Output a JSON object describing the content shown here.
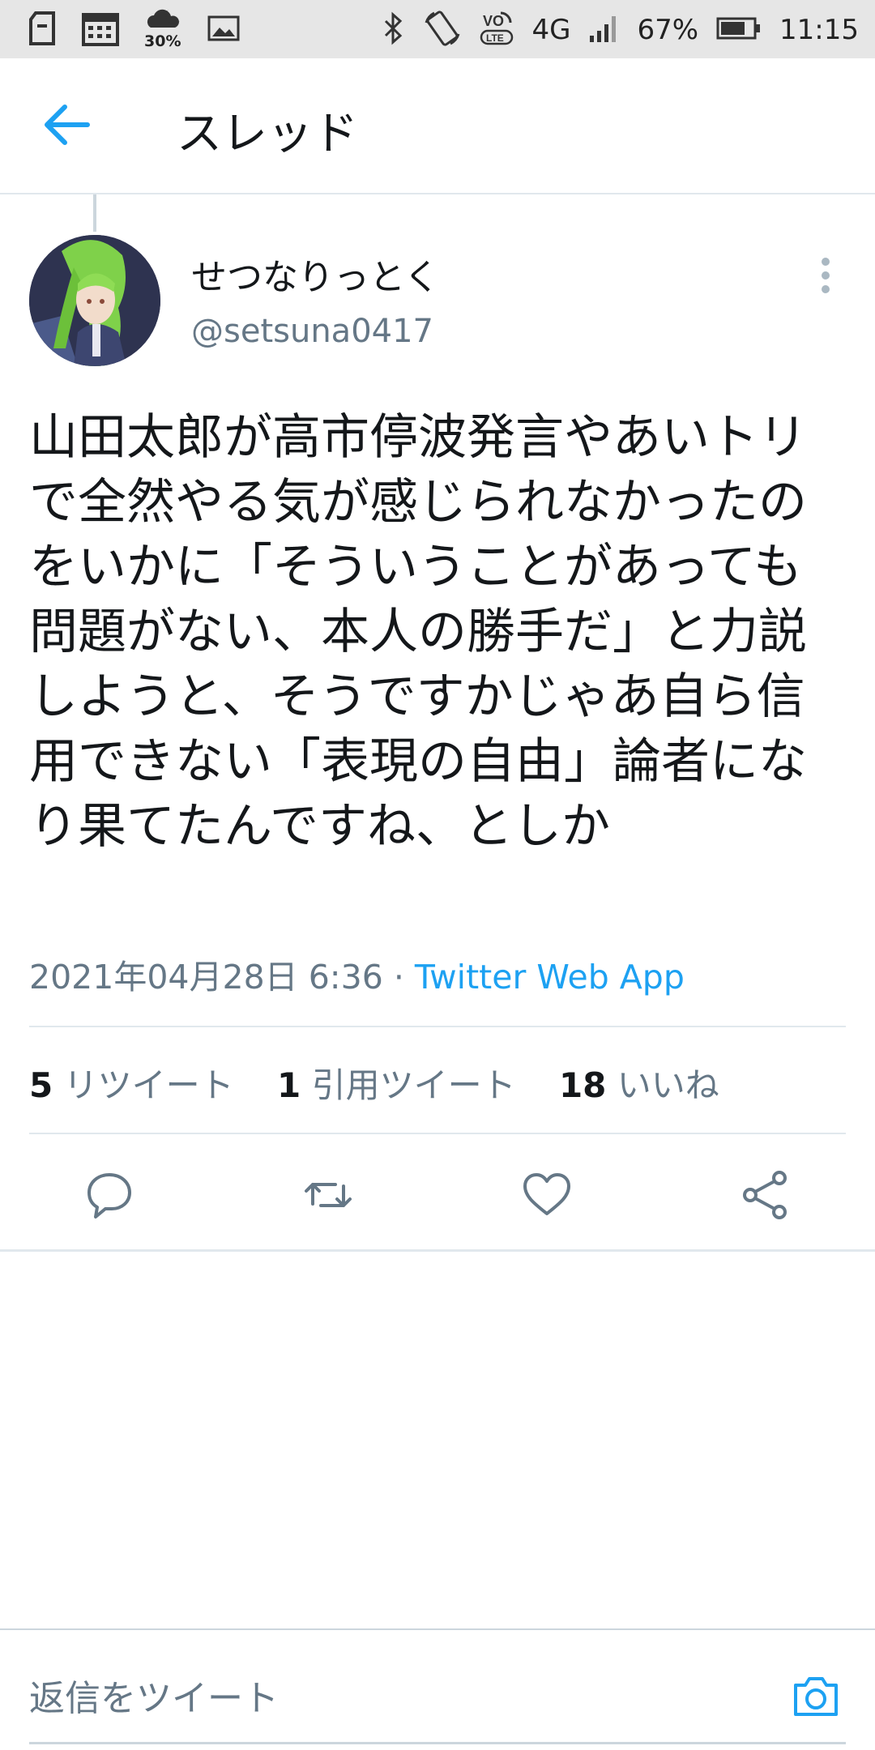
{
  "status_bar": {
    "weather_percent": "30%",
    "network": "4G",
    "battery": "67%",
    "time": "11:15",
    "icons": [
      "sd-card-icon",
      "calendar-icon",
      "weather-icon",
      "image-icon",
      "bluetooth-icon",
      "rotate-icon",
      "volte-icon",
      "signal-icon",
      "battery-icon"
    ]
  },
  "header": {
    "title": "スレッド"
  },
  "tweet": {
    "display_name": "せつなりっとく",
    "handle": "@setsuna0417",
    "text": "山田太郎が高市停波発言やあいトリで全然やる気が感じられなかったのをいかに「そういうことがあっても問題がない、本人の勝手だ」と力説しようと、そうですかじゃあ自ら信用できない「表現の自由」論者になり果てたんですね、としか",
    "timestamp": "2021年04月28日 6:36 · ",
    "source": "Twitter Web App",
    "stats": {
      "retweets_count": "5",
      "retweets_label": "リツイート",
      "quotes_count": "1",
      "quotes_label": "引用ツイート",
      "likes_count": "18",
      "likes_label": "いいね"
    }
  },
  "reply": {
    "placeholder": "返信をツイート"
  },
  "colors": {
    "accent": "#1da1f2",
    "secondary_text": "#657786",
    "divider": "#e1e8ed"
  }
}
